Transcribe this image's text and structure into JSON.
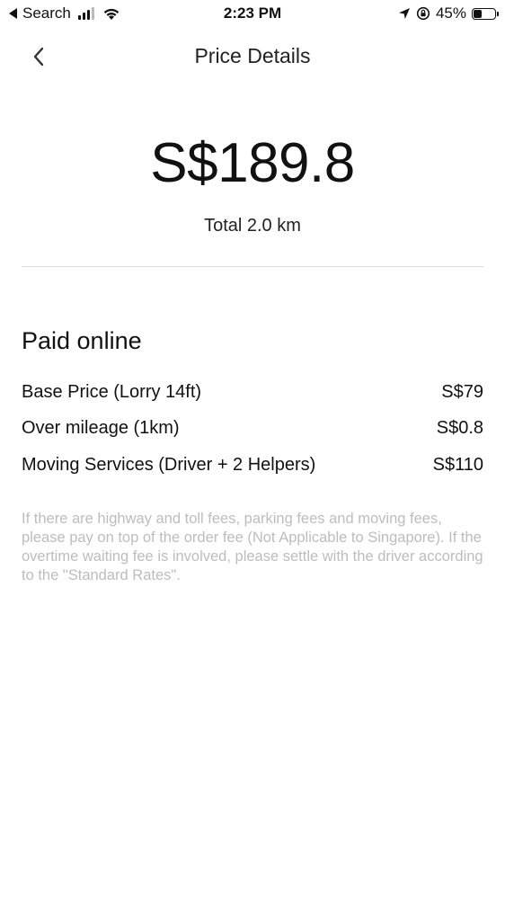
{
  "status_bar": {
    "back_app": "Search",
    "time": "2:23 PM",
    "battery": "45%",
    "battery_level": 0.45,
    "icons": [
      "signal-icon",
      "wifi-icon",
      "location-arrow-icon",
      "orientation-lock-icon",
      "battery-icon"
    ]
  },
  "nav": {
    "title": "Price Details",
    "back_icon": "chevron-left-icon"
  },
  "summary": {
    "total_price": "S$189.8",
    "total_distance": "Total 2.0 km"
  },
  "paid_online": {
    "title": "Paid online",
    "items": [
      {
        "label": "Base Price (Lorry 14ft)",
        "amount": "S$79"
      },
      {
        "label": "Over mileage (1km)",
        "amount": "S$0.8"
      },
      {
        "label": "Moving Services (Driver + 2 Helpers)",
        "amount": "S$110"
      }
    ]
  },
  "notice": "If there are highway and toll fees, parking fees and moving fees, please pay on top of the order fee (Not Applicable to Singapore). If the overtime waiting fee is involved, please settle with the driver according to the \"Standard Rates\"."
}
